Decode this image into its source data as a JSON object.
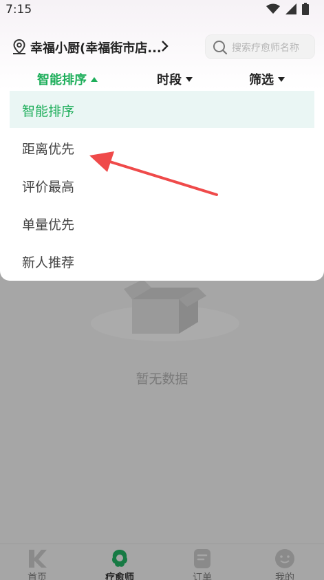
{
  "status_bar": {
    "time": "7:15"
  },
  "header": {
    "location": "幸福小厨(幸福街市店...",
    "search_placeholder": "搜索疗愈师名称"
  },
  "tabs": [
    {
      "label": "智能排序",
      "active": true
    },
    {
      "label": "时段",
      "active": false
    },
    {
      "label": "筛选",
      "active": false
    }
  ],
  "sort_menu": {
    "items": [
      {
        "label": "智能排序",
        "selected": true
      },
      {
        "label": "距离优先",
        "selected": false
      },
      {
        "label": "评价最高",
        "selected": false
      },
      {
        "label": "单量优先",
        "selected": false
      },
      {
        "label": "新人推荐",
        "selected": false
      }
    ]
  },
  "empty_state": {
    "text": "暂无数据"
  },
  "bottom_nav": [
    {
      "label": "首页",
      "icon": "home-k-icon",
      "active": false
    },
    {
      "label": "疗愈师",
      "icon": "therapist-icon",
      "active": true
    },
    {
      "label": "订单",
      "icon": "orders-icon",
      "active": false
    },
    {
      "label": "我的",
      "icon": "smiley-icon",
      "active": false
    }
  ],
  "colors": {
    "accent": "#1dae5a",
    "selected_bg": "#eaf6f4",
    "overlay": "#a6a6a6",
    "annotation_arrow": "#ef4a4a"
  }
}
